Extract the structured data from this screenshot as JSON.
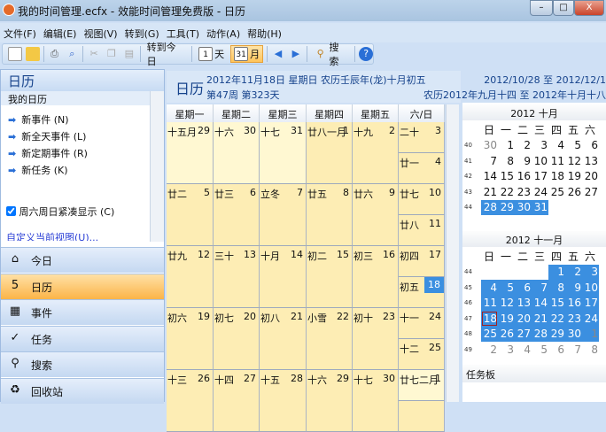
{
  "window": {
    "title": "我的时间管理.ecfx - 效能时间管理免费版 - 日历",
    "minimize": "–",
    "maximize": "□",
    "close": "X"
  },
  "menu": [
    "文件(F)",
    "编辑(E)",
    "视图(V)",
    "转到(G)",
    "工具(T)",
    "动作(A)",
    "帮助(H)"
  ],
  "toolbar": {
    "today": "转到今日",
    "day_icon": "1",
    "day": "天",
    "month_icon": "31",
    "month": "月",
    "search": "搜索",
    "help": "?"
  },
  "left": {
    "title": "日历",
    "section": "我的日历",
    "tasks": [
      "新事件 (N)",
      "新全天事件 (L)",
      "新定期事件 (R)",
      "新任务 (K)"
    ],
    "compact_label": "周六周日紧凑显示 (C)",
    "compact_checked": true,
    "customize": "自定义当前视图(U)...",
    "nav": [
      {
        "label": "今日",
        "icon": "⌂"
      },
      {
        "label": "日历",
        "icon": "5"
      },
      {
        "label": "事件",
        "icon": "▦"
      },
      {
        "label": "任务",
        "icon": "✓"
      },
      {
        "label": "搜索",
        "icon": "⚲"
      },
      {
        "label": "回收站",
        "icon": "♻"
      }
    ]
  },
  "header": {
    "title": "日历",
    "date": "2012年11月18日 星期日 农历壬辰年(龙)十月初五",
    "week": "第47周 第323天",
    "range": "2012/10/28 至 2012/12/1",
    "lunar_range": "农历2012年九月十四 至 2012年十月十八"
  },
  "weekdays": [
    "星期一",
    "星期二",
    "星期三",
    "星期四",
    "星期五",
    "六/日"
  ],
  "weeks": [
    [
      [
        "十五月",
        "29"
      ],
      [
        "十六",
        "30"
      ],
      [
        "十七",
        "31"
      ],
      [
        "廿八一月",
        "1"
      ],
      [
        "十九",
        "2"
      ],
      [
        "二十",
        "3"
      ],
      [
        "廿一",
        "4"
      ]
    ],
    [
      [
        "廿二",
        "5"
      ],
      [
        "廿三",
        "6"
      ],
      [
        "立冬",
        "7"
      ],
      [
        "廿五",
        "8"
      ],
      [
        "廿六",
        "9"
      ],
      [
        "廿七",
        "10"
      ],
      [
        "廿八",
        "11"
      ]
    ],
    [
      [
        "廿九",
        "12"
      ],
      [
        "三十",
        "13"
      ],
      [
        "十月",
        "14"
      ],
      [
        "初二",
        "15"
      ],
      [
        "初三",
        "16"
      ],
      [
        "初四",
        "17"
      ],
      [
        "初五",
        "18"
      ]
    ],
    [
      [
        "初六",
        "19"
      ],
      [
        "初七",
        "20"
      ],
      [
        "初八",
        "21"
      ],
      [
        "小雪",
        "22"
      ],
      [
        "初十",
        "23"
      ],
      [
        "十一",
        "24"
      ],
      [
        "十二",
        "25"
      ]
    ],
    [
      [
        "十三",
        "26"
      ],
      [
        "十四",
        "27"
      ],
      [
        "十五",
        "28"
      ],
      [
        "十六",
        "29"
      ],
      [
        "十七",
        "30"
      ],
      [
        "廿七二月",
        "1"
      ],
      [
        "",
        ""
      ]
    ]
  ],
  "today": "18",
  "mini": {
    "dow": [
      "日",
      "一",
      "二",
      "三",
      "四",
      "五",
      "六"
    ],
    "months": [
      {
        "title": "2012 十月",
        "weeks": [
          [
            "40",
            "30",
            "1",
            "2",
            "3",
            "4",
            "5",
            "6"
          ],
          [
            "41",
            "7",
            "8",
            "9",
            "10",
            "11",
            "12",
            "13"
          ],
          [
            "42",
            "14",
            "15",
            "16",
            "17",
            "18",
            "19",
            "20"
          ],
          [
            "43",
            "21",
            "22",
            "23",
            "24",
            "25",
            "26",
            "27"
          ],
          [
            "44",
            "28",
            "29",
            "30",
            "31",
            "",
            "",
            ""
          ]
        ]
      },
      {
        "title": "2012 十一月",
        "weeks": [
          [
            "44",
            "",
            "",
            "",
            "",
            "1",
            "2",
            "3"
          ],
          [
            "45",
            "4",
            "5",
            "6",
            "7",
            "8",
            "9",
            "10"
          ],
          [
            "46",
            "11",
            "12",
            "13",
            "14",
            "15",
            "16",
            "17"
          ],
          [
            "47",
            "18",
            "19",
            "20",
            "21",
            "22",
            "23",
            "24"
          ],
          [
            "48",
            "25",
            "26",
            "27",
            "28",
            "29",
            "30",
            "1"
          ],
          [
            "49",
            "2",
            "3",
            "4",
            "5",
            "6",
            "7",
            "8"
          ]
        ]
      }
    ]
  },
  "taskboard": "任务板",
  "colors": {
    "accent": "#3b8fe0",
    "cell": "#fdedb4",
    "selected_nav": "#fbb448"
  }
}
